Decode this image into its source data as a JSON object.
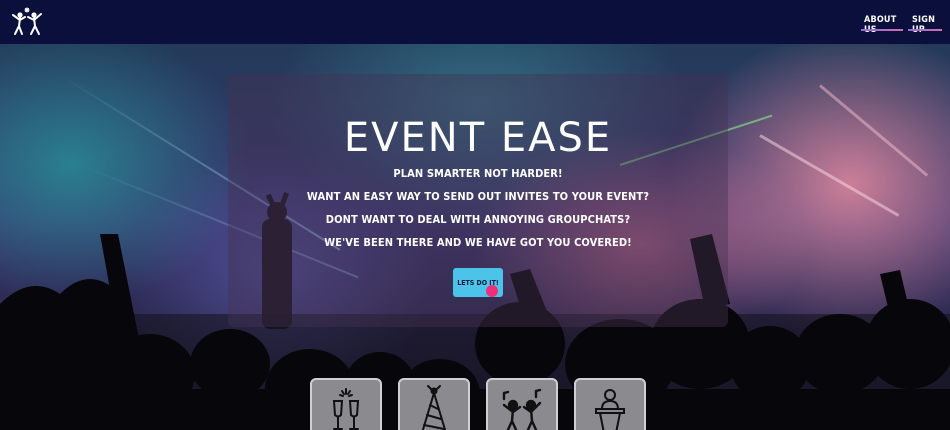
{
  "nav": {
    "logo_icon": "dancing-people-icon",
    "links": [
      {
        "label": "ABOUT US"
      },
      {
        "label": "SIGN UP"
      }
    ]
  },
  "hero": {
    "title": "EVENT EASE",
    "lines": [
      "PLAN SMARTER NOT HARDER!",
      "WANT AN EASY WAY TO SEND OUT INVITES TO YOUR EVENT?",
      "DONT WANT TO DEAL WITH ANNOYING GROUPCHATS?",
      "WE'VE BEEN THERE AND WE HAVE GOT YOU COVERED!"
    ],
    "cta_label": "LETS DO IT!"
  },
  "features": [
    {
      "icon": "champagne-glasses-icon"
    },
    {
      "icon": "party-hat-icon"
    },
    {
      "icon": "dancing-party-icon"
    },
    {
      "icon": "podium-speaker-icon"
    }
  ],
  "colors": {
    "nav_bg": "#0b0f3b",
    "cta_bg": "#4cc3e8",
    "nav_underline": "#b46ec6",
    "cursor": "#ee2f7a"
  }
}
